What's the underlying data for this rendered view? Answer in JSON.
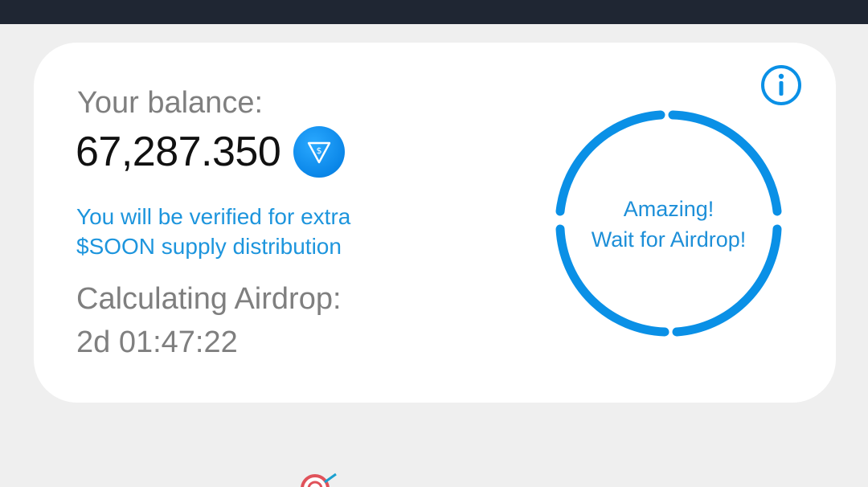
{
  "balance": {
    "label": "Your balance:",
    "amount": "67,287.350",
    "token_icon": "dollar-triangle-icon"
  },
  "verification": {
    "line1": "You will be verified for extra",
    "line2": "$SOON supply distribution"
  },
  "airdrop": {
    "calculating_label": "Calculating Airdrop:",
    "countdown": "2d 01:47:22",
    "status_line1": "Amazing!",
    "status_line2": "Wait for Airdrop!"
  },
  "icons": {
    "info": "info-icon",
    "bottom": "target-icon"
  },
  "colors": {
    "accent": "#0a90e6",
    "link_text": "#1d95dd",
    "muted_text": "#7f7f7f",
    "status_bar": "#1f2633",
    "background": "#efefef",
    "card": "#ffffff"
  }
}
